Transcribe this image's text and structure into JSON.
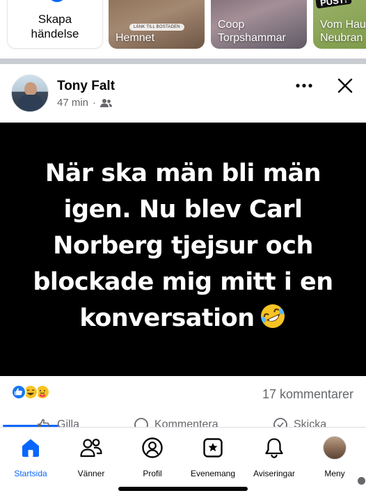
{
  "stories": {
    "create_label": "Skapa\nhändelse",
    "items": [
      {
        "label": "Hemnet",
        "badge": "LÄNK TILL BOSTADEN"
      },
      {
        "label": "Coop\nTorpshammar"
      },
      {
        "label": "Vom Hau\nNeubran",
        "badge": "PUST!"
      }
    ]
  },
  "post": {
    "author": "Tony Falt",
    "time": "47 min",
    "separator": "·",
    "audience_icon": "friends-icon",
    "text": "När ska män bli män igen. Nu blev Carl Norberg tjejsur och blockade mig mitt i en konversation",
    "text_emoji": "rolling-on-floor-laughing",
    "reactions": [
      "like",
      "haha",
      "care"
    ],
    "comments": "17 kommentarer",
    "actions": [
      "Gilla",
      "Kommentera",
      "Skicka"
    ]
  },
  "nav": {
    "items": [
      {
        "label": "Startsida",
        "icon": "home-icon",
        "active": true
      },
      {
        "label": "Vänner",
        "icon": "friends-icon",
        "active": false
      },
      {
        "label": "Profil",
        "icon": "profile-icon",
        "active": false
      },
      {
        "label": "Evenemang",
        "icon": "calendar-star-icon",
        "active": false
      },
      {
        "label": "Aviseringar",
        "icon": "bell-icon",
        "active": false
      },
      {
        "label": "Meny",
        "icon": "avatar",
        "active": false
      }
    ]
  },
  "colors": {
    "accent": "#0866ff",
    "muted_text": "#65676b",
    "post_background": "#000000"
  }
}
